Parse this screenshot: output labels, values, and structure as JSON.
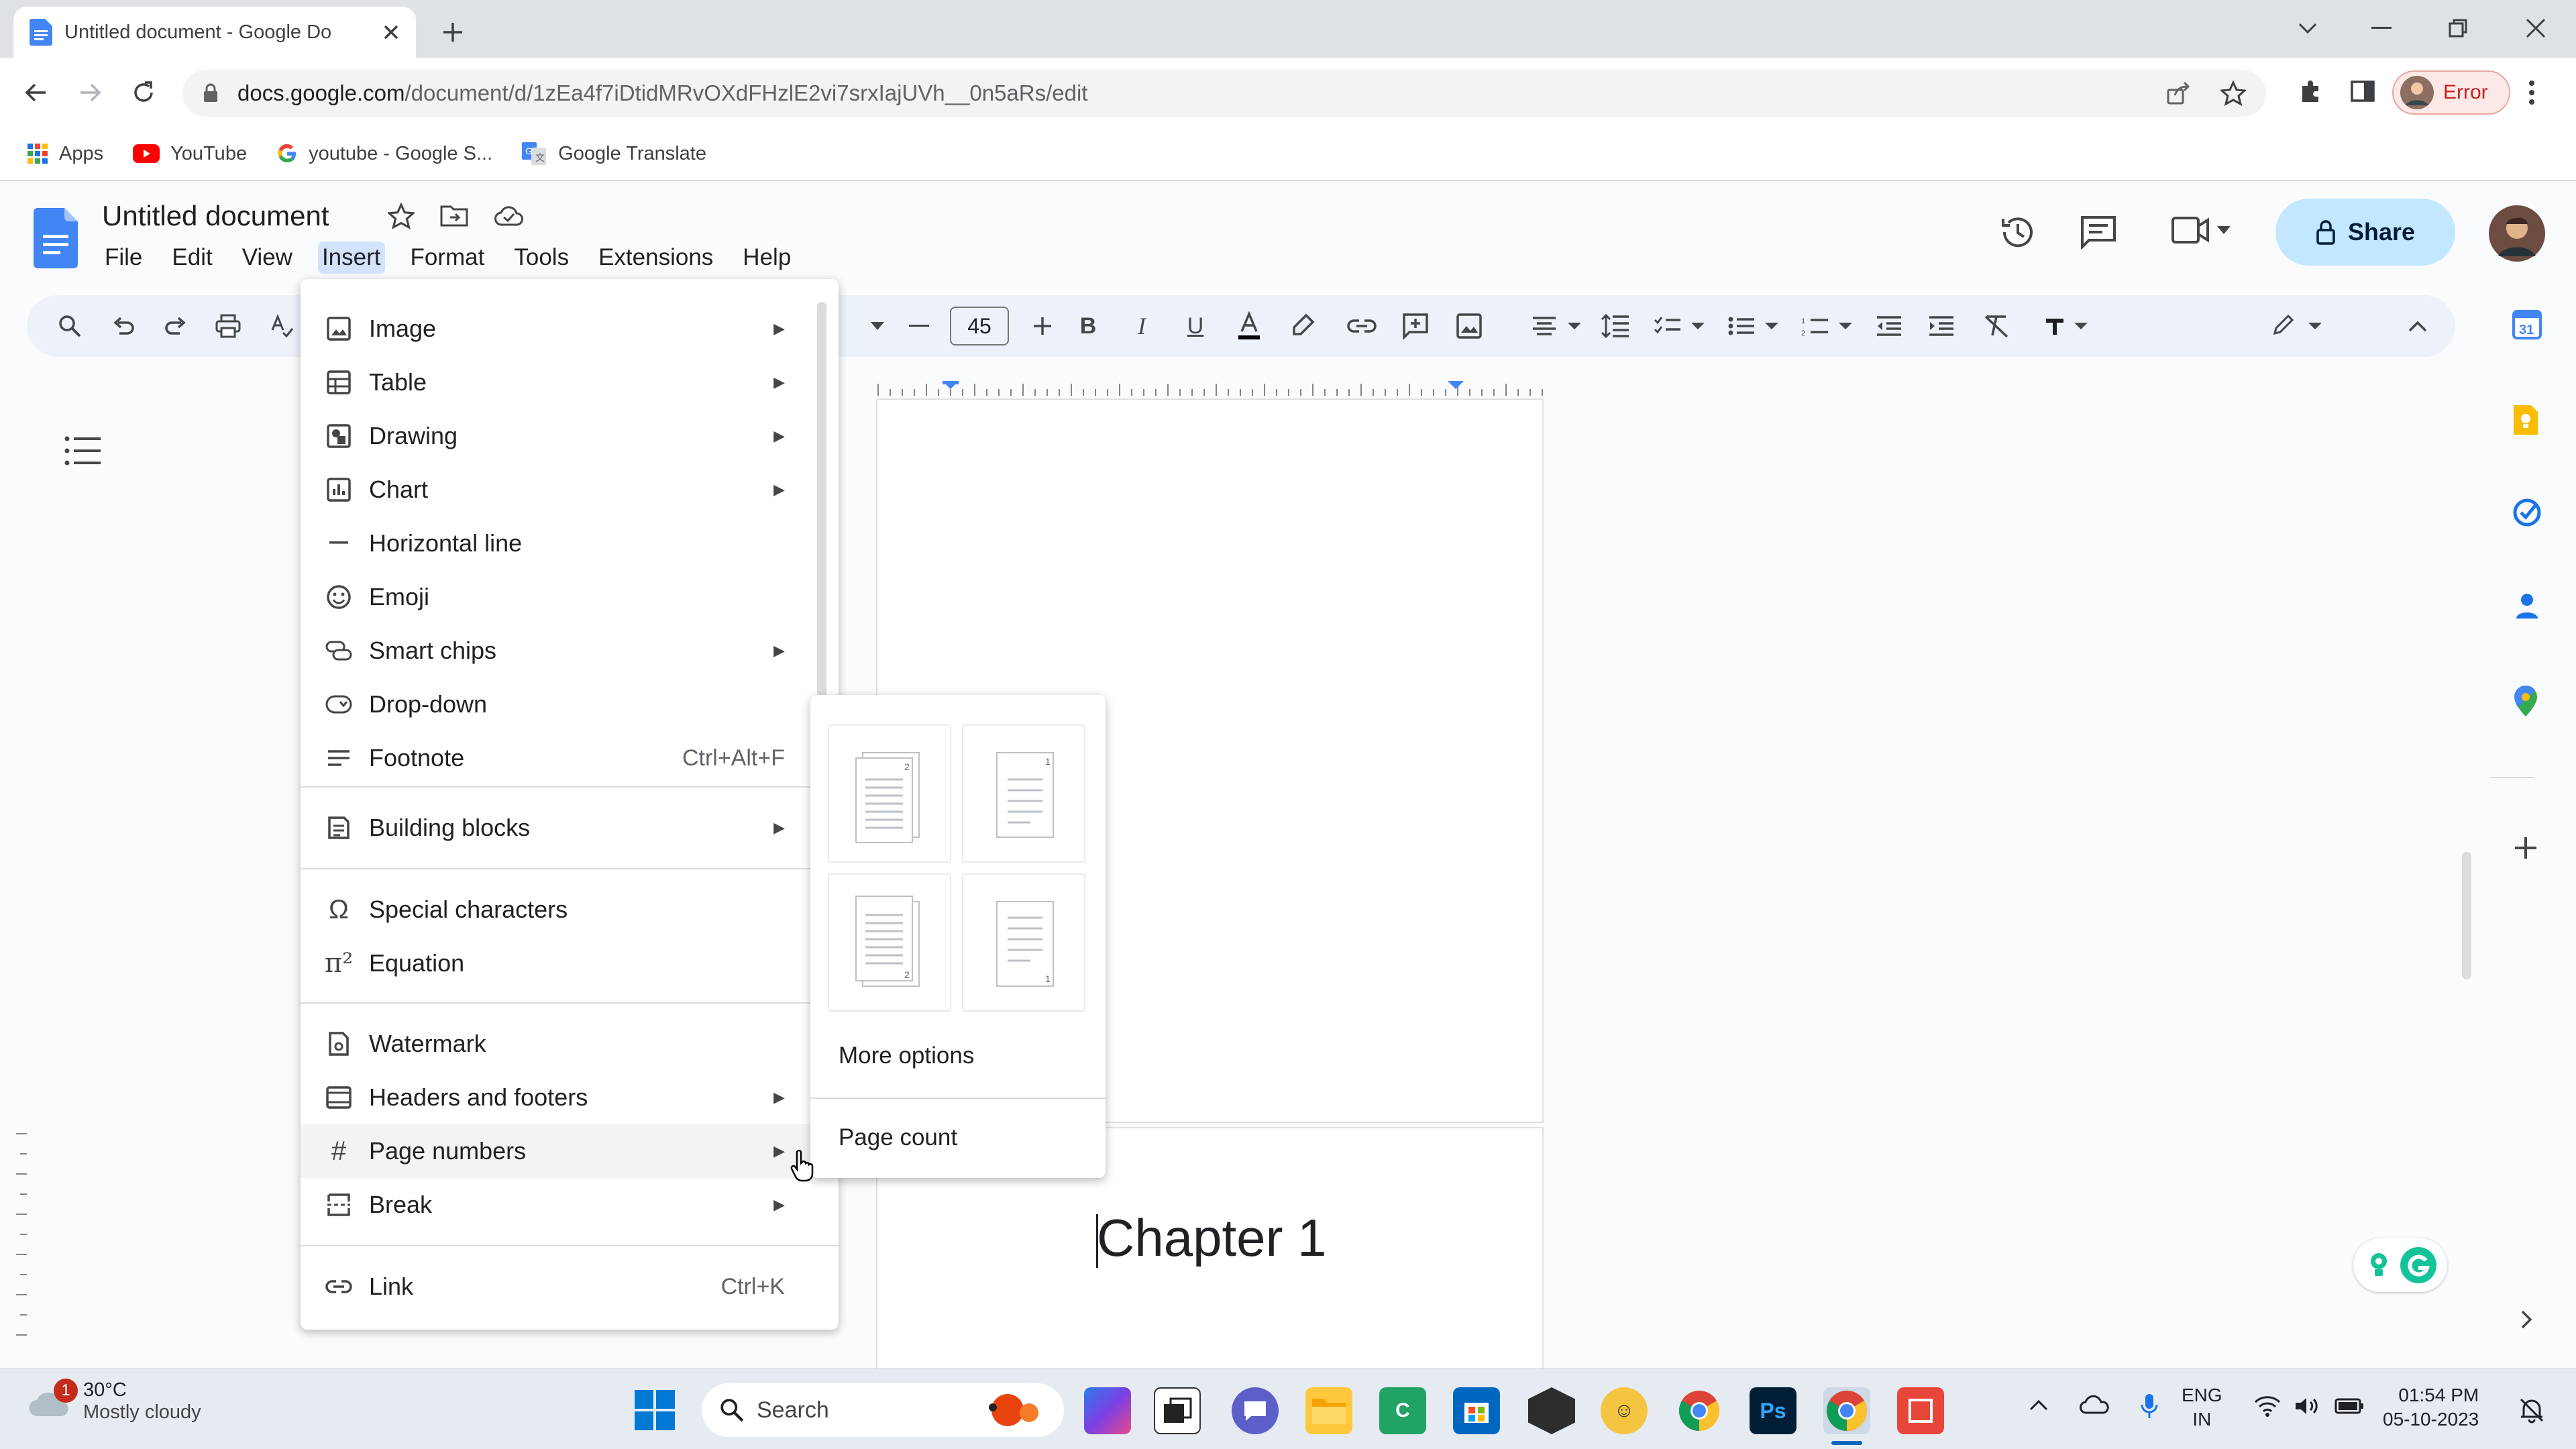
{
  "browser": {
    "tab_title": "Untitled document - Google Do",
    "url_host": "docs.google.com",
    "url_path": "/document/d/1zEa4f7iDtidMRvOXdFHzlE2vi7srxIajUVh__0n5aRs/edit",
    "profile_label": "Error"
  },
  "bookmarks": [
    {
      "label": "Apps",
      "icon": "apps-grid-icon"
    },
    {
      "label": "YouTube",
      "icon": "youtube-icon"
    },
    {
      "label": "youtube - Google S...",
      "icon": "google-icon"
    },
    {
      "label": "Google Translate",
      "icon": "translate-icon"
    }
  ],
  "docs": {
    "title": "Untitled document",
    "menus": [
      "File",
      "Edit",
      "View",
      "Insert",
      "Format",
      "Tools",
      "Extensions",
      "Help"
    ],
    "active_menu": "Insert",
    "share_label": "Share",
    "font_size": "45",
    "body_text": "Chapter 1"
  },
  "insert_menu": {
    "items": [
      {
        "label": "Image",
        "icon": "image-icon",
        "submenu": true
      },
      {
        "label": "Table",
        "icon": "table-icon",
        "submenu": true
      },
      {
        "label": "Drawing",
        "icon": "drawing-icon",
        "submenu": true
      },
      {
        "label": "Chart",
        "icon": "chart-icon",
        "submenu": true
      },
      {
        "label": "Horizontal line",
        "icon": "horizontal-line-icon",
        "submenu": false
      },
      {
        "label": "Emoji",
        "icon": "emoji-icon",
        "submenu": false
      },
      {
        "label": "Smart chips",
        "icon": "smart-chips-icon",
        "submenu": true
      },
      {
        "label": "Drop-down",
        "icon": "dropdown-icon",
        "submenu": false
      },
      {
        "label": "Footnote",
        "icon": "footnote-icon",
        "shortcut": "Ctrl+Alt+F"
      },
      {
        "label": "Building blocks",
        "icon": "building-blocks-icon",
        "submenu": true
      },
      {
        "label": "Special characters",
        "icon": "omega-icon",
        "submenu": false
      },
      {
        "label": "Equation",
        "icon": "pi-icon",
        "submenu": false
      },
      {
        "label": "Watermark",
        "icon": "watermark-icon",
        "submenu": false
      },
      {
        "label": "Headers and footers",
        "icon": "headers-footers-icon",
        "submenu": true
      },
      {
        "label": "Page numbers",
        "icon": "hash-icon",
        "submenu": true
      },
      {
        "label": "Break",
        "icon": "break-icon",
        "submenu": true
      },
      {
        "label": "Link",
        "icon": "link-icon",
        "shortcut": "Ctrl+K"
      }
    ],
    "highlighted": "Page numbers"
  },
  "page_numbers_submenu": {
    "more_options": "More options",
    "page_count": "Page count"
  },
  "taskbar": {
    "temperature": "30°C",
    "weather": "Mostly cloudy",
    "weather_badge": "1",
    "search_label": "Search",
    "lang_line1": "ENG",
    "lang_line2": "IN",
    "time": "01:54 PM",
    "date": "05-10-2023"
  },
  "colors": {
    "docs_blue": "#4285f4",
    "share_bg": "#c2e7ff",
    "menu_highlight": "#f1f3f4"
  }
}
